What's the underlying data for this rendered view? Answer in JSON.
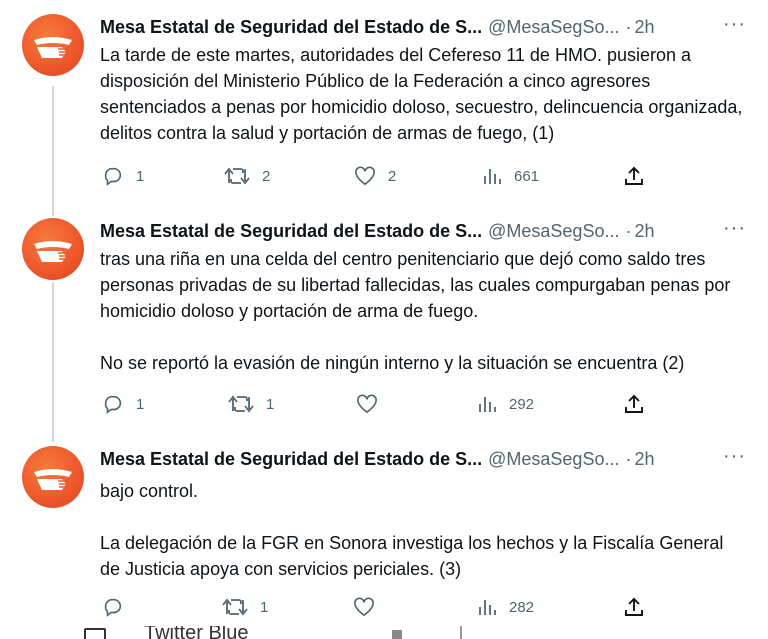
{
  "tweets": [
    {
      "name": "Mesa Estatal de Seguridad del Estado de S...",
      "handle": "@MesaSegSo...",
      "time": "2h",
      "text": "La tarde de este martes, autoridades del Cefereso 11 de HMO. pusieron a disposición del Ministerio Público de la Federación a cinco agresores sentenciados a penas por homicidio doloso, secuestro, delincuencia organizada, delitos contra la salud y portación de armas de fuego, (1)",
      "replies": "1",
      "retweets": "2",
      "likes": "2",
      "views": "661"
    },
    {
      "name": "Mesa Estatal de Seguridad del Estado de S...",
      "handle": "@MesaSegSo...",
      "time": "2h",
      "text": "tras una riña en una celda del centro penitenciario que dejó como saldo tres personas privadas de su libertad fallecidas, las cuales compurgaban penas por homicidio doloso y portación de arma de fuego.\n\nNo se reportó la evasión de ningún interno y la situación se encuentra (2)",
      "replies": "1",
      "retweets": "1",
      "likes": "",
      "views": "292"
    },
    {
      "name": "Mesa Estatal de Seguridad del Estado de S...",
      "handle": "@MesaSegSo...",
      "time": "2h",
      "text": "bajo control.\n\nLa delegación de la FGR en Sonora investiga los hechos y la Fiscalía General de Justicia apoya con servicios periciales. (3)",
      "replies": "",
      "retweets": "1",
      "likes": "",
      "views": "282"
    }
  ],
  "separator_dot": "·",
  "more_glyph": "···",
  "bottom_partial_text": "Twitter Blue",
  "colors": {
    "avatar": "#ee5a2d",
    "text": "#0f1419",
    "muted": "#536471",
    "thread_line": "#cfd9de"
  },
  "icons": [
    "reply-icon",
    "retweet-icon",
    "like-icon",
    "views-icon",
    "share-icon",
    "more-icon"
  ]
}
